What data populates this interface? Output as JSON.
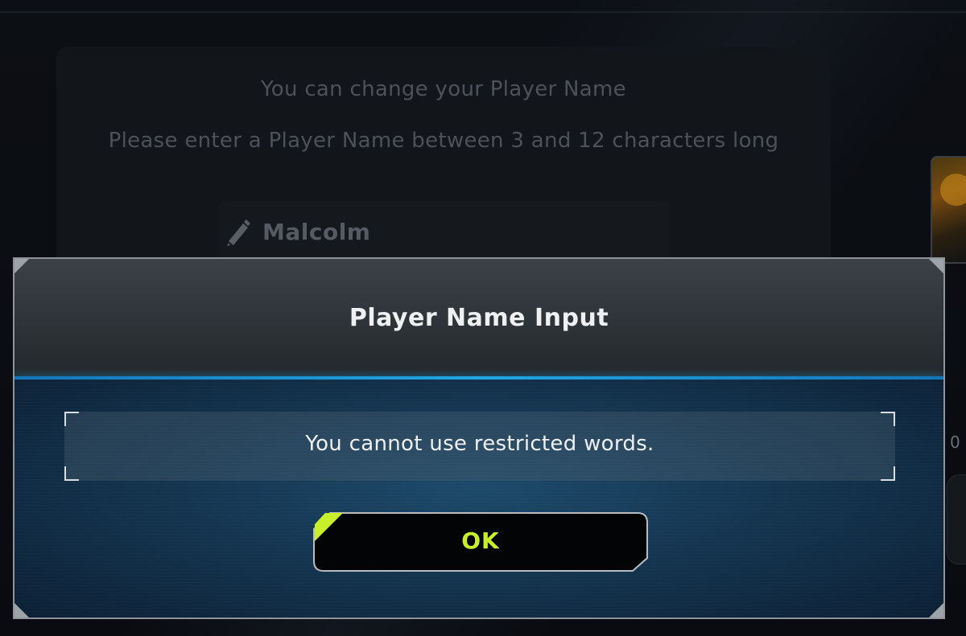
{
  "background": {
    "title": "You can change your Player Name",
    "subtitle": "Please enter a Player Name between 3 and 12 characters long",
    "name_value": "Malcolm",
    "side_number": "0"
  },
  "dialog": {
    "title": "Player Name Input",
    "message": "You cannot use restricted words.",
    "ok_label": "OK"
  },
  "colors": {
    "accent_blue": "#21a6e8",
    "ok_text": "#c8f02a",
    "dialog_border": "#8f949a"
  }
}
